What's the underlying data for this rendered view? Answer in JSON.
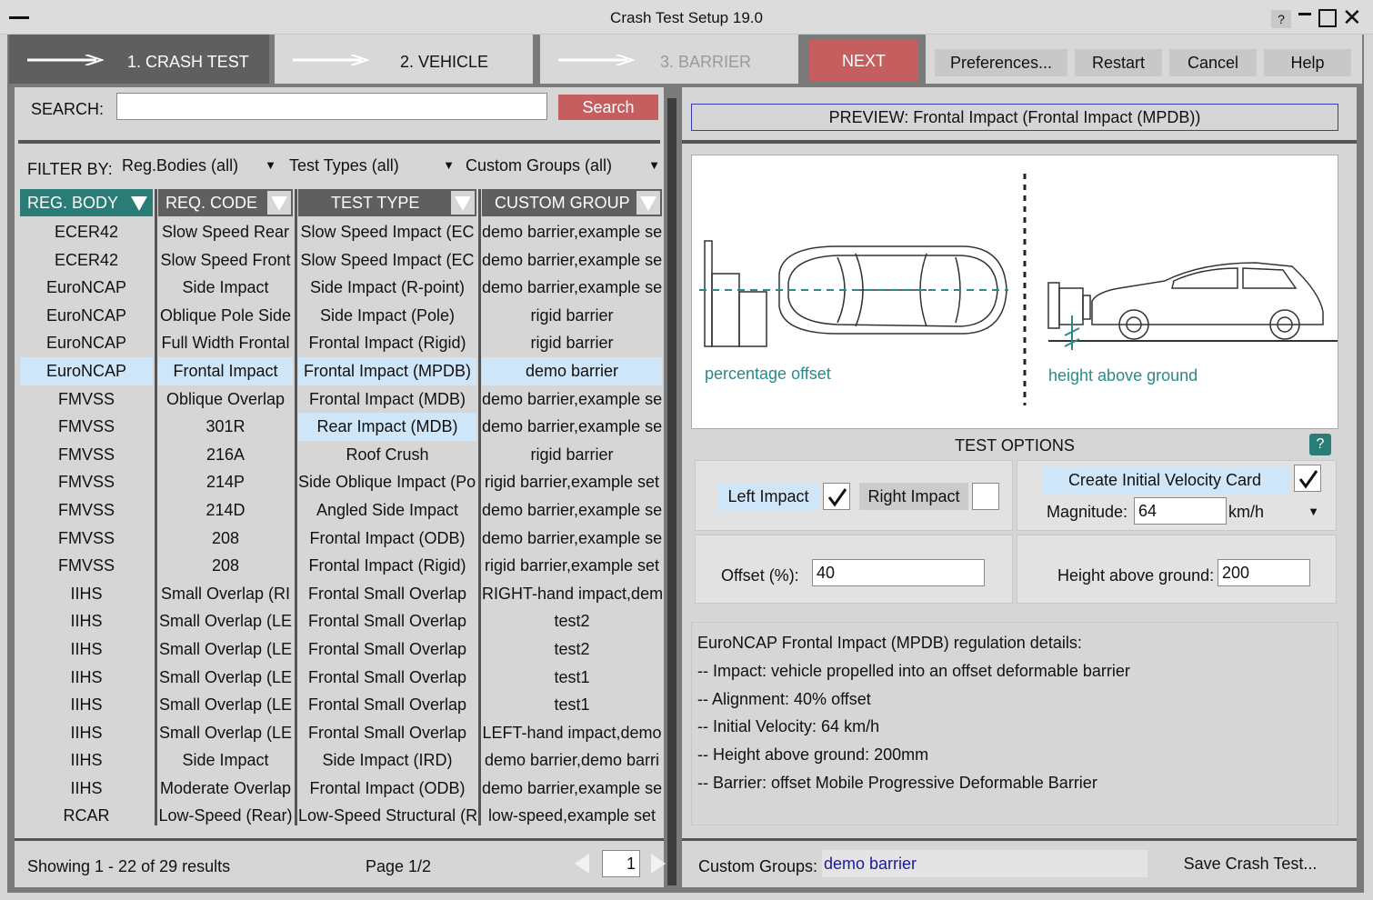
{
  "window": {
    "title": "Crash Test Setup 19.0",
    "help_glyph": "?"
  },
  "tabs": [
    {
      "label": "1. CRASH TEST"
    },
    {
      "label": "2. VEHICLE"
    },
    {
      "label": "3. BARRIER"
    }
  ],
  "toolbar": {
    "next_label": "NEXT",
    "preferences_label": "Preferences...",
    "restart_label": "Restart",
    "cancel_label": "Cancel",
    "help_label": "Help"
  },
  "search": {
    "label": "SEARCH:",
    "value": "",
    "button_label": "Search"
  },
  "filter": {
    "label": "FILTER BY:",
    "reg_bodies": "Reg.Bodies (all)",
    "test_types": "Test Types (all)",
    "custom_groups": "Custom Groups (all)"
  },
  "table": {
    "headers": [
      "REG. BODY",
      "REQ. CODE",
      "TEST TYPE",
      "CUSTOM GROUP"
    ],
    "reg_body": [
      "ECER42",
      "ECER42",
      "EuroNCAP",
      "EuroNCAP",
      "EuroNCAP",
      "EuroNCAP",
      "FMVSS",
      "FMVSS",
      "FMVSS",
      "FMVSS",
      "FMVSS",
      "FMVSS",
      "FMVSS",
      "IIHS",
      "IIHS",
      "IIHS",
      "IIHS",
      "IIHS",
      "IIHS",
      "IIHS",
      "IIHS",
      "RCAR"
    ],
    "req_code": [
      "Slow Speed Rear",
      "Slow Speed Front",
      "Side Impact",
      "Oblique Pole Side",
      "Full Width Frontal",
      "Frontal Impact",
      "Oblique Overlap",
      "301R",
      "216A",
      "214P",
      "214D",
      "208",
      "208",
      "Small Overlap (RI",
      "Small Overlap (LE",
      "Small Overlap (LE",
      "Small Overlap (LE",
      "Small Overlap (LE",
      "Small Overlap (LE",
      "Side Impact",
      "Moderate Overlap",
      "Low-Speed (Rear)"
    ],
    "test_type": [
      "Slow Speed Impact (EC",
      "Slow Speed Impact (EC",
      "Side Impact (R-point)",
      "Side Impact (Pole)",
      "Frontal Impact (Rigid)",
      "Frontal Impact (MPDB)",
      "Frontal Impact (MDB)",
      "Rear Impact (MDB)",
      "Roof Crush",
      "Side Oblique Impact (Pol",
      "Angled Side Impact",
      "Frontal Impact (ODB)",
      "Frontal Impact (Rigid)",
      "Frontal Small Overlap",
      "Frontal Small Overlap",
      "Frontal Small Overlap",
      "Frontal Small Overlap",
      "Frontal Small Overlap",
      "Frontal Small Overlap",
      "Side Impact (IRD)",
      "Frontal Impact (ODB)",
      "Low-Speed Structural (R"
    ],
    "custom_group": [
      "demo barrier,example se",
      "demo barrier,example se",
      "demo barrier,example se",
      "rigid barrier",
      "rigid barrier",
      "demo barrier",
      "demo barrier,example se",
      "demo barrier,example se",
      "rigid barrier",
      "rigid barrier,example set",
      "demo barrier,example se",
      "demo barrier,example se",
      "rigid barrier,example set",
      "RIGHT-hand impact,dem",
      "test2",
      "test2",
      "test1",
      "test1",
      "LEFT-hand impact,demo",
      "demo barrier,demo barri",
      "demo barrier,example se",
      "low-speed,example set"
    ]
  },
  "pagination": {
    "showing": "Showing 1 - 22 of 29 results",
    "page": "Page 1/2",
    "page_input": "1"
  },
  "preview": {
    "title": "PREVIEW: Frontal Impact (Frontal Impact (MPDB))",
    "label_left": "percentage offset",
    "label_right": "height above ground"
  },
  "options": {
    "title": "TEST OPTIONS",
    "help_glyph": "?",
    "left_impact": "Left Impact",
    "right_impact": "Right Impact",
    "create_velocity": "Create Initial Velocity Card",
    "magnitude_label": "Magnitude:",
    "magnitude_value": "64",
    "unit": "km/h",
    "offset_label": "Offset (%):",
    "offset_value": "40",
    "height_label": "Height above ground:",
    "height_value": "200"
  },
  "details": [
    "EuroNCAP Frontal Impact (MPDB) regulation details:",
    "-- Impact: vehicle propelled into an offset deformable barrier",
    "-- Alignment: 40% offset",
    "-- Initial Velocity: 64 km/h",
    "-- Height above ground: 200mm",
    "-- Barrier: offset Mobile Progressive Deformable Barrier"
  ],
  "footer": {
    "custom_groups_label": "Custom Groups:",
    "custom_groups_value": "demo barrier",
    "save_label": "Save Crash Test..."
  },
  "colors": {
    "accent_red": "#c55f5f",
    "teal": "#2a7d77",
    "selection": "#cfe5f8"
  }
}
